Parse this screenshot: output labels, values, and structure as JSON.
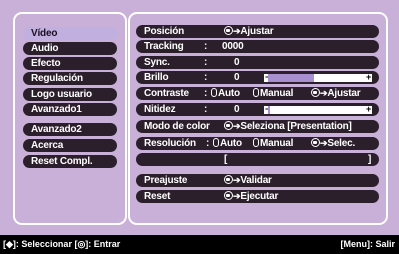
{
  "menu": {
    "items": [
      "Vídeo",
      "Audio",
      "Efecto",
      "Regulación",
      "Logo usuario",
      "Avanzado1",
      "Avanzado2",
      "Acerca",
      "Reset Compl."
    ],
    "active_index": 0
  },
  "settings": {
    "posicion": {
      "label": "Posición",
      "action": "Ajustar"
    },
    "tracking": {
      "label": "Tracking",
      "sep": ":",
      "value": "0000"
    },
    "sync": {
      "label": "Sync.",
      "sep": ":",
      "value": "0"
    },
    "brillo": {
      "label": "Brillo",
      "sep": ":",
      "value": "0",
      "level": 0.5
    },
    "contraste": {
      "label": "Contraste",
      "sep": ":",
      "opt1": "Auto",
      "opt2": "Manual",
      "action": "Ajustar"
    },
    "nitidez": {
      "label": "Nitidez",
      "sep": ":",
      "value": "0",
      "level": 0.0
    },
    "modo_color": {
      "label": "Modo de color",
      "action": "Seleziona [Presentation]"
    },
    "resolucion": {
      "label": "Resolución",
      "sep": ":",
      "opt1": "Auto",
      "opt2": "Manual",
      "action": "Selec."
    },
    "res_bracket_open": "[",
    "res_bracket_close": "]",
    "preajuste": {
      "label": "Preajuste",
      "action": "Validar"
    },
    "reset": {
      "label": "Reset",
      "action": "Ejecutar"
    }
  },
  "status_bar": {
    "left": "[◆]: Seleccionar [◎]: Entrar",
    "right": "[Menu]: Salir"
  },
  "colors": {
    "background": "#c8b0d8",
    "row": "#2b1f2b",
    "active": "#c0b0e0",
    "bar_fill": "#a890d0"
  }
}
